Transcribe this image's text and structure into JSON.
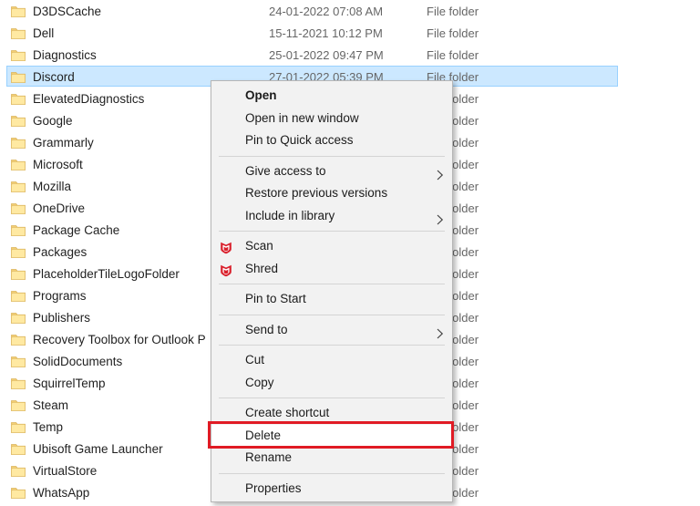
{
  "colors": {
    "selection_bg": "#cce8ff",
    "selection_border": "#99d1ff",
    "menu_bg": "#f2f2f2",
    "menu_border": "#b6b6b6",
    "separator": "#d4d4d4",
    "annotation_red": "#e01b24",
    "mcafee_red": "#d91f2b",
    "folder_back": "#f3cf74",
    "folder_front": "#ffe9a2",
    "folder_edge": "#dcb55e",
    "text_primary": "#1f1f1f",
    "text_secondary": "#666666"
  },
  "file_list": {
    "rows": [
      {
        "name": "D3DSCache",
        "date_modified": "24-01-2022 07:08 AM",
        "type": "File folder",
        "selected": false
      },
      {
        "name": "Dell",
        "date_modified": "15-11-2021 10:12 PM",
        "type": "File folder",
        "selected": false
      },
      {
        "name": "Diagnostics",
        "date_modified": "25-01-2022 09:47 PM",
        "type": "File folder",
        "selected": false
      },
      {
        "name": "Discord",
        "date_modified": "27-01-2022 05:39 PM",
        "type": "File folder",
        "selected": true
      },
      {
        "name": "ElevatedDiagnostics",
        "date_modified": "",
        "type": "File folder",
        "selected": false
      },
      {
        "name": "Google",
        "date_modified": "",
        "type": "File folder",
        "selected": false
      },
      {
        "name": "Grammarly",
        "date_modified": "",
        "type": "File folder",
        "selected": false
      },
      {
        "name": "Microsoft",
        "date_modified": "",
        "type": "File folder",
        "selected": false
      },
      {
        "name": "Mozilla",
        "date_modified": "",
        "type": "File folder",
        "selected": false
      },
      {
        "name": "OneDrive",
        "date_modified": "",
        "type": "File folder",
        "selected": false
      },
      {
        "name": "Package Cache",
        "date_modified": "",
        "type": "File folder",
        "selected": false
      },
      {
        "name": "Packages",
        "date_modified": "",
        "type": "File folder",
        "selected": false
      },
      {
        "name": "PlaceholderTileLogoFolder",
        "date_modified": "",
        "type": "File folder",
        "selected": false
      },
      {
        "name": "Programs",
        "date_modified": "",
        "type": "File folder",
        "selected": false
      },
      {
        "name": "Publishers",
        "date_modified": "",
        "type": "File folder",
        "selected": false
      },
      {
        "name": "Recovery Toolbox for Outlook P",
        "date_modified": "",
        "type": "File folder",
        "selected": false
      },
      {
        "name": "SolidDocuments",
        "date_modified": "",
        "type": "File folder",
        "selected": false
      },
      {
        "name": "SquirrelTemp",
        "date_modified": "",
        "type": "File folder",
        "selected": false
      },
      {
        "name": "Steam",
        "date_modified": "",
        "type": "File folder",
        "selected": false
      },
      {
        "name": "Temp",
        "date_modified": "",
        "type": "File folder",
        "selected": false
      },
      {
        "name": "Ubisoft Game Launcher",
        "date_modified": "",
        "type": "File folder",
        "selected": false
      },
      {
        "name": "VirtualStore",
        "date_modified": "",
        "type": "File folder",
        "selected": false
      },
      {
        "name": "WhatsApp",
        "date_modified": "",
        "type": "File folder",
        "selected": false
      }
    ]
  },
  "context_menu": {
    "items": [
      {
        "id": "open",
        "label": "Open",
        "bold": true
      },
      {
        "id": "open-in-new-window",
        "label": "Open in new window"
      },
      {
        "id": "pin-to-quick-access",
        "label": "Pin to Quick access"
      },
      {
        "type": "separator"
      },
      {
        "id": "give-access-to",
        "label": "Give access to",
        "submenu": true
      },
      {
        "id": "restore-previous-versions",
        "label": "Restore previous versions"
      },
      {
        "id": "include-in-library",
        "label": "Include in library",
        "submenu": true
      },
      {
        "type": "separator"
      },
      {
        "id": "scan",
        "label": "Scan",
        "icon": "mcafee-shield-icon"
      },
      {
        "id": "shred",
        "label": "Shred",
        "icon": "mcafee-shield-icon"
      },
      {
        "type": "separator"
      },
      {
        "id": "pin-to-start",
        "label": "Pin to Start"
      },
      {
        "type": "separator"
      },
      {
        "id": "send-to",
        "label": "Send to",
        "submenu": true
      },
      {
        "type": "separator"
      },
      {
        "id": "cut",
        "label": "Cut"
      },
      {
        "id": "copy",
        "label": "Copy"
      },
      {
        "type": "separator"
      },
      {
        "id": "create-shortcut",
        "label": "Create shortcut"
      },
      {
        "id": "delete",
        "label": "Delete",
        "annotated": true
      },
      {
        "id": "rename",
        "label": "Rename"
      },
      {
        "type": "separator"
      },
      {
        "id": "properties",
        "label": "Properties"
      }
    ]
  },
  "annotation": {
    "type": "red-rectangle",
    "target": "delete-menu-item"
  }
}
